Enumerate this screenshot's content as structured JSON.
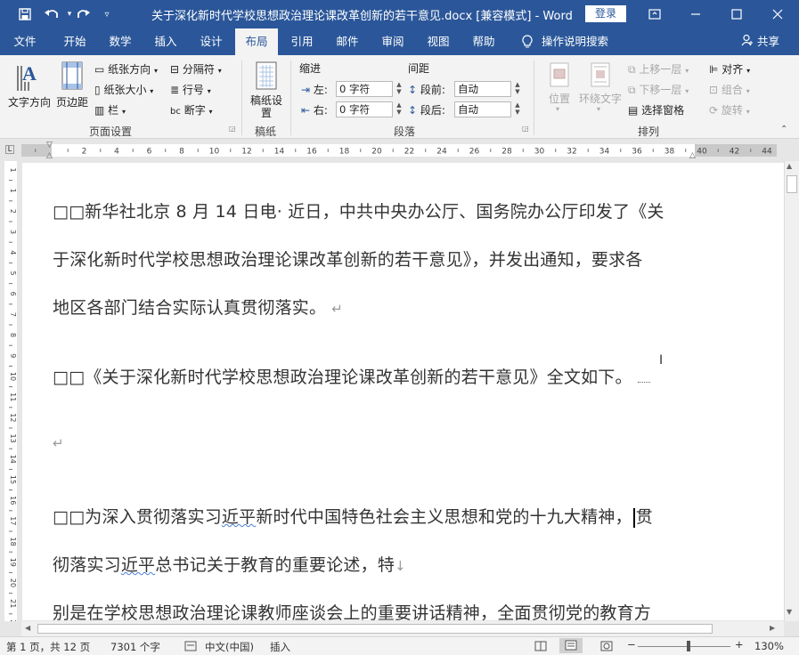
{
  "window": {
    "title": "关于深化新时代学校思想政治理论课改革创新的若干意见.docx [兼容模式] - Word",
    "login_label": "登录",
    "quick_access": [
      "save-icon",
      "undo-icon",
      "redo-icon",
      "customize-icon"
    ],
    "controls": [
      "ribbon-display-icon",
      "minimize-icon",
      "maximize-icon",
      "close-icon"
    ]
  },
  "tabs": [
    {
      "label": "文件"
    },
    {
      "label": "开始"
    },
    {
      "label": "数学"
    },
    {
      "label": "插入"
    },
    {
      "label": "设计"
    },
    {
      "label": "布局",
      "active": true
    },
    {
      "label": "引用"
    },
    {
      "label": "邮件"
    },
    {
      "label": "审阅"
    },
    {
      "label": "视图"
    },
    {
      "label": "帮助"
    }
  ],
  "tell_me": "操作说明搜索",
  "share_label": "共享",
  "ribbon": {
    "page_setup": {
      "text_direction": "文字方向",
      "margins": "页边距",
      "orientation": "纸张方向",
      "size": "纸张大小",
      "columns": "栏",
      "breaks": "分隔符",
      "line_numbers": "行号",
      "hyphenation": "断字",
      "group_label": "页面设置"
    },
    "manuscript": {
      "label": "稿纸设置",
      "group_label": "稿纸"
    },
    "paragraph": {
      "indent_label": "缩进",
      "spacing_label": "间距",
      "left_label": "左:",
      "right_label": "右:",
      "left_value": "0 字符",
      "right_value": "0 字符",
      "before_label": "段前:",
      "after_label": "段后:",
      "before_value": "自动",
      "after_value": "自动",
      "group_label": "段落"
    },
    "arrange": {
      "position": "位置",
      "wrap_text": "环绕文字",
      "bring_forward": "上移一层",
      "send_backward": "下移一层",
      "selection_pane": "选择窗格",
      "align": "对齐",
      "group": "组合",
      "rotate": "旋转",
      "group_label": "排列"
    }
  },
  "ruler": {
    "labels": [
      "2",
      "2",
      "4",
      "6",
      "8",
      "10",
      "12",
      "14",
      "16",
      "18",
      "20",
      "22",
      "24",
      "26",
      "28",
      "30",
      "32",
      "34",
      "36",
      "38",
      "40",
      "42",
      "44"
    ]
  },
  "vruler": {
    "labels": [
      "1",
      "1",
      "2",
      "3",
      "4",
      "5",
      "6",
      "7",
      "8",
      "9",
      "10",
      "11",
      "12",
      "13",
      "14",
      "15",
      "16",
      "17",
      "18",
      "19",
      "20",
      "21",
      "22"
    ]
  },
  "document": {
    "para1": {
      "lines": [
        "□□新华社北京 8 月 14 日电· 近日，中共中央办公厅、国务院办公厅印发了《关",
        "于深化新时代学校思想政治理论课改革创新的若干意见》，并发出通知，要求各",
        "地区各部门结合实际认真贯彻落实。"
      ]
    },
    "para2": "□□《关于深化新时代学校思想政治理论课改革创新的若干意见》全文如下。",
    "para4": {
      "line1_a": "□□为深入贯彻落实习",
      "line1_b": "近平",
      "line1_c": "新时代中国特色社会主义思想和党的十九大精神，",
      "line1_d": "贯",
      "line2_a": "彻落实习",
      "line2_b": "近平",
      "line2_c": "总书记关于教育的重要论述，特",
      "line3": "别是在学校思想政治理论课教师座谈会上的重要讲话精神，全面贯彻党的教育方"
    }
  },
  "status": {
    "page": "第 1 页，共 12 页",
    "words": "7301 个字",
    "language": "中文(中国)",
    "mode": "插入",
    "zoom": "130%"
  },
  "colors": {
    "accent": "#2b579a",
    "ribbon_bg": "#f3f3f3",
    "spell_underline": "#4a7fd6"
  }
}
